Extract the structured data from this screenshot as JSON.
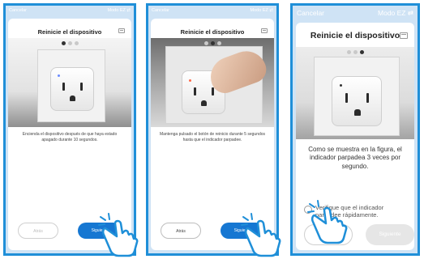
{
  "panels": [
    {
      "topbar": {
        "cancel": "Cancelar",
        "mode": "Modo EZ ⇄"
      },
      "title": "Reinicie el dispositivo",
      "step": 1,
      "steps_total": 3,
      "instruction": "Encienda el dispositivo después de que haya estado apagado durante 10 segundos.",
      "back_label": "Atrás",
      "next_label": "Siguiente"
    },
    {
      "topbar": {
        "cancel": "Cancelar",
        "mode": "Modo EZ ⇄"
      },
      "title": "Reinicie el dispositivo",
      "step": 2,
      "steps_total": 3,
      "instruction": "Mantenga pulsado el botón de reinicio durante 5 segundos hasta que el indicador parpadee.",
      "back_label": "Atrás",
      "next_label": "Siguiente"
    },
    {
      "topbar": {
        "cancel": "Cancelar",
        "mode": "Modo EZ ⇄"
      },
      "title": "Reinicie el dispositivo",
      "step": 3,
      "steps_total": 3,
      "instruction": "Como se muestra en la figura, el indicador parpadea 3 veces por segundo.",
      "confirm_label": "Verifique que el indicador parpadee rápidamente.",
      "confirm_checked": false,
      "next_label": "Siguiente"
    }
  ],
  "colors": {
    "frame_border": "#1f8fd8",
    "primary_button": "#1677d2",
    "led_p1": "#6c8cff",
    "led_p2": "#ff6a4a",
    "led_p3": "#333333"
  },
  "icons": [
    "menu-icon",
    "pointing-hand-icon"
  ]
}
